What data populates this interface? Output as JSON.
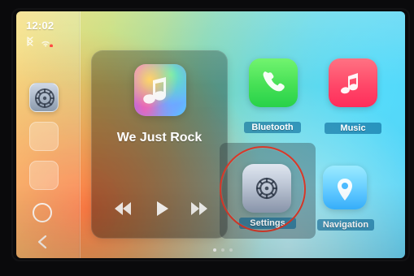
{
  "status_bar": {
    "time": "12:02",
    "icons": [
      "bluetooth-icon",
      "wifi-icon"
    ]
  },
  "sidebar": {
    "items": [
      {
        "icon": "settings-icon",
        "active": true
      },
      {
        "icon": "",
        "active": false
      },
      {
        "icon": "",
        "active": false
      }
    ],
    "home_icon": "home-icon",
    "back_icon": "back-icon"
  },
  "now_playing": {
    "title": "We Just Rock",
    "album_icon": "music-note-icon",
    "controls": [
      "rewind-icon",
      "play-icon",
      "fast-forward-icon"
    ]
  },
  "apps": [
    {
      "name": "Bluetooth",
      "icon": "phone-icon"
    },
    {
      "name": "Music",
      "icon": "music-note-icon"
    },
    {
      "name": "Settings",
      "icon": "settings-icon"
    },
    {
      "name": "Navigation",
      "icon": "location-pin-icon"
    }
  ],
  "pagination": {
    "current": 1,
    "total": 3
  },
  "colors": {
    "highlight_circle": "#d33a2b",
    "label_bg": "#00598c"
  }
}
